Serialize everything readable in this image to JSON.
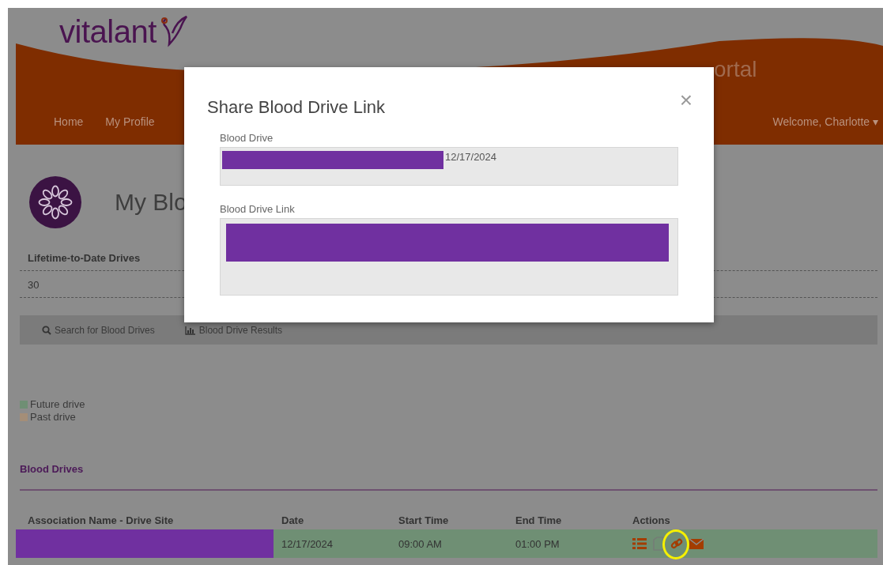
{
  "header": {
    "logo": "vitalant",
    "portal_title": "ortal",
    "nav": [
      {
        "label": "Home"
      },
      {
        "label": "My Profile"
      }
    ],
    "user_menu": "Welcome, Charlotte",
    "user_menu_caret": "▾"
  },
  "page": {
    "title": "My Blo",
    "stats": [
      {
        "label": "Lifetime-to-Date Drives",
        "value": "30"
      }
    ],
    "toolbar": [
      {
        "kind": "search",
        "label": "Search for Blood Drives"
      },
      {
        "kind": "results",
        "label": "Blood Drive Results"
      }
    ],
    "legend": [
      {
        "kind": "future",
        "label": "Future drive",
        "color": "#6f8f74"
      },
      {
        "kind": "past",
        "label": "Past drive",
        "color": "#a48e78"
      }
    ],
    "section_title": "Blood Drives",
    "table": {
      "columns": [
        "Association Name - Drive Site",
        "Date",
        "Start Time",
        "End Time",
        "Actions"
      ],
      "rows": [
        {
          "kind": "future",
          "site_redacted": true,
          "date": "12/17/2024",
          "start_time": "09:00 AM",
          "end_time": "01:00 PM",
          "actions": [
            {
              "kind": "list",
              "highlighted": false
            },
            {
              "kind": "document",
              "highlighted": false
            },
            {
              "kind": "link",
              "highlighted": true
            },
            {
              "kind": "mail",
              "highlighted": false
            }
          ]
        }
      ]
    }
  },
  "modal": {
    "title": "Share Blood Drive Link",
    "close": "×",
    "fields": [
      {
        "kind": "single",
        "label": "Blood Drive",
        "redacted": true,
        "value": "12/17/2024"
      },
      {
        "kind": "multi",
        "label": "Blood Drive Link",
        "redacted": true
      }
    ]
  }
}
